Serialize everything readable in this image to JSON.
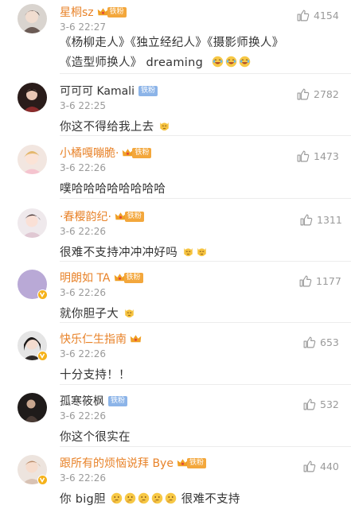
{
  "comments": [
    {
      "user": "星桐sz",
      "time": "3-6 22:27",
      "fan_tag": "铁粉",
      "line1": "《杨柳走人》《独立经纪人》《摄影师换人》",
      "line2": "《造型师换人》 dreaming",
      "likes": "4154"
    },
    {
      "user": "可可可 Kamali",
      "time": "3-6 22:25",
      "fan_tag": "铁粉",
      "text": "你这不得给我上去",
      "likes": "2782"
    },
    {
      "user": "小橘嘎嘣脆·",
      "time": "3-6 22:26",
      "fan_tag": "铁粉",
      "text": "噗哈哈哈哈哈哈哈哈",
      "likes": "1473"
    },
    {
      "user": "·春樱韵纪·",
      "time": "3-6 22:26",
      "fan_tag": "铁粉",
      "text": "很难不支持冲冲冲好吗",
      "likes": "1311"
    },
    {
      "user": "明朗如 TA",
      "time": "3-6 22:26",
      "fan_tag": "铁粉",
      "text": "就你胆子大",
      "likes": "1177"
    },
    {
      "user": "快乐仁生指南",
      "time": "3-6 22:26",
      "text": "十分支持！！",
      "likes": "653"
    },
    {
      "user": "孤寒筱枫",
      "time": "3-6 22:26",
      "fan_tag": "铁粉",
      "text": "你这个很实在",
      "likes": "532"
    },
    {
      "user": "跟所有的烦恼说拜 Bye",
      "time": "3-6 22:26",
      "fan_tag": "铁粉",
      "text_a": "你 big胆",
      "text_b": "很难不支持",
      "likes": "440"
    }
  ],
  "colors": {
    "orange_name": "#e8832a",
    "dark_name": "#333333",
    "time_gray": "#9a9a9a",
    "gold_tag": "#f3a73c",
    "blue_tag": "#8cb4e8"
  },
  "icons": {
    "like": "thumbs-up-icon",
    "crown": "crown-icon",
    "verified": "v-badge-icon",
    "emoji_laugh": "laughing-face-emoji",
    "emoji_cat": "cat-face-emoji",
    "emoji_think": "thinking-face-emoji"
  }
}
